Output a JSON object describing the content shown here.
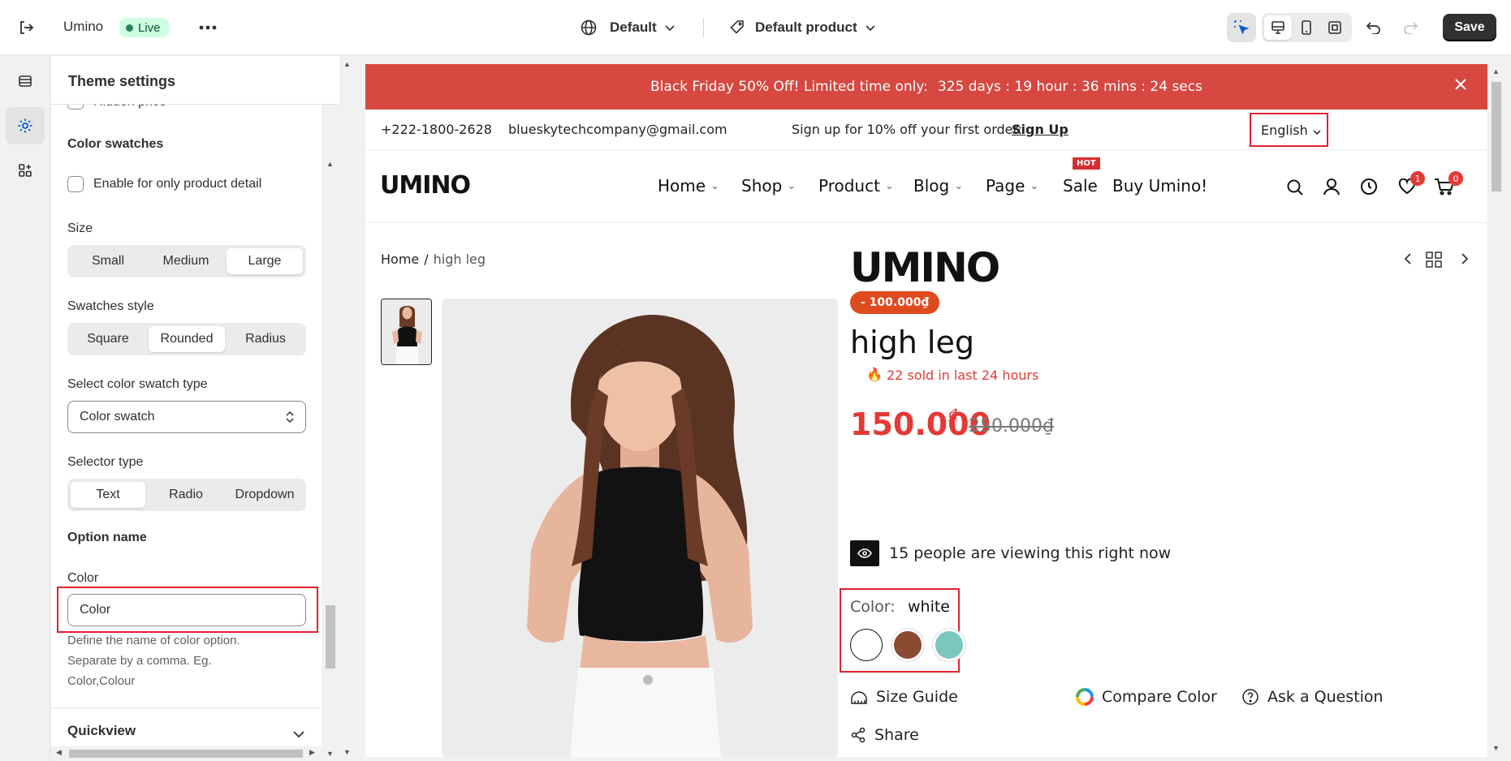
{
  "topbar": {
    "store_name": "Umino",
    "status": "Live",
    "theme_selector": "Default",
    "template_selector": "Default product",
    "save_label": "Save"
  },
  "panel": {
    "title": "Theme settings",
    "hidden_price_label": "Hidden price",
    "color_swatches_heading": "Color swatches",
    "enable_detail_label": "Enable for only product detail",
    "size_label": "Size",
    "size_options": [
      "Small",
      "Medium",
      "Large"
    ],
    "size_selected": "Large",
    "swatch_style_label": "Swatches style",
    "swatch_style_options": [
      "Square",
      "Rounded",
      "Radius"
    ],
    "swatch_style_selected": "Rounded",
    "swatch_type_label": "Select color swatch type",
    "swatch_type_value": "Color swatch",
    "selector_type_label": "Selector type",
    "selector_type_options": [
      "Text",
      "Radio",
      "Dropdown"
    ],
    "selector_type_selected": "Text",
    "option_name_heading": "Option name",
    "color_label": "Color",
    "color_value": "Color",
    "help_text": "Define the name of color option. Separate by a comma. Eg. Color,Colour",
    "quickview_label": "Quickview"
  },
  "preview": {
    "promo_text": "Black Friday 50% Off! Limited time only:",
    "countdown": "325 days : 19 hour : 36 mins : 24 secs",
    "phone": "+222-1800-2628",
    "email": "blueskytechcompany@gmail.com",
    "signup_text": "Sign up for 10% off your first order:",
    "signup_link": "Sign Up",
    "language": "English",
    "logo": "UMINO",
    "nav": [
      "Home",
      "Shop",
      "Product",
      "Blog",
      "Page",
      "Sale",
      "Buy Umino!"
    ],
    "hot_badge": "HOT",
    "wishlist_count": "1",
    "cart_count": "0",
    "breadcrumb_home": "Home",
    "breadcrumb_sep": "/",
    "breadcrumb_current": "high leg",
    "brand_logo": "UMINO",
    "discount_badge": "- 100.000₫",
    "product_title": "high leg",
    "sold_text": "22 sold in last 24 hours",
    "price": "150.000",
    "price_currency": "₫",
    "compare_price": "250.000₫",
    "viewers_text": "15 people are viewing this right now",
    "color_label": "Color:",
    "color_value": "white",
    "swatches": [
      "#ffffff",
      "#8b4a32",
      "#7cc6c0"
    ],
    "size_guide": "Size Guide",
    "compare_color": "Compare Color",
    "ask_question": "Ask a Question",
    "share": "Share"
  },
  "colors": {
    "accent_red": "#e0202e",
    "promo_bg": "#d64840",
    "price_red": "#e53935"
  }
}
